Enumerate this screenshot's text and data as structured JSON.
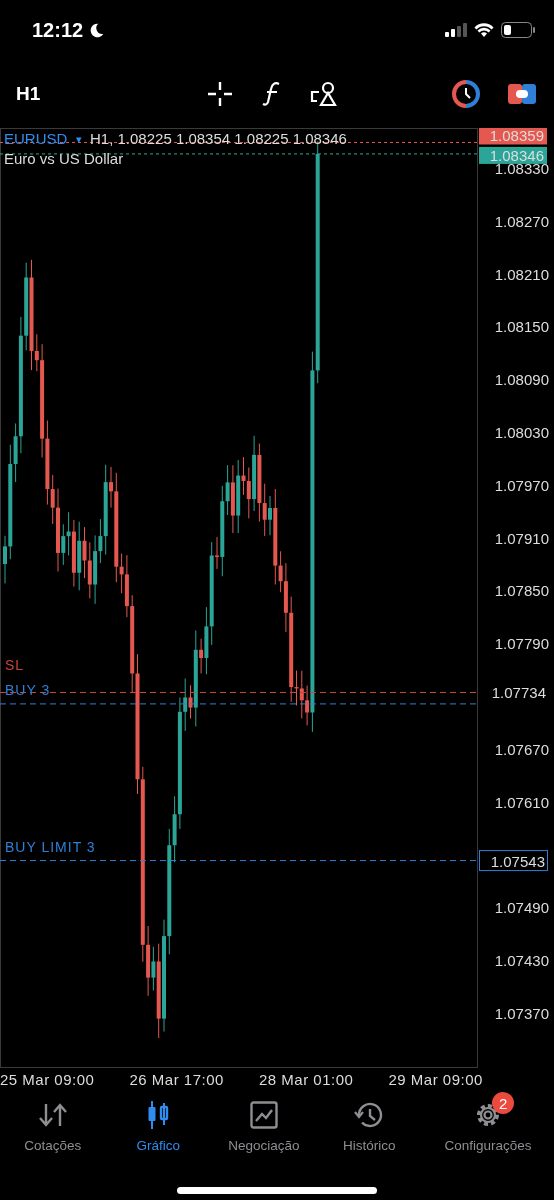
{
  "status_bar": {
    "time": "12:12"
  },
  "toolbar": {
    "timeframe": "H1"
  },
  "chart": {
    "symbol": "EURUSD",
    "dropdown": "▾",
    "ohlc": "H1, 1.08225 1.08354 1.08225 1.08346",
    "description": "Euro vs US Dollar",
    "price_ticks": [
      "1.08330",
      "1.08270",
      "1.08210",
      "1.08150",
      "1.08090",
      "1.08030",
      "1.07970",
      "1.07910",
      "1.07850",
      "1.07790",
      "1.07670",
      "1.07610",
      "1.07490",
      "1.07430",
      "1.07370"
    ],
    "price_lines": [
      {
        "kind": "ask",
        "price": "1.08359",
        "color": "#e5584f"
      },
      {
        "kind": "bid",
        "price": "1.08346",
        "color": "#2ba597"
      }
    ],
    "orders": [
      {
        "kind": "stop",
        "label": "SL",
        "price": "1.07734",
        "color": "#c9463d"
      },
      {
        "kind": "position",
        "label": "BUY 3",
        "color": "#2f7fd6"
      },
      {
        "kind": "limit",
        "label": "BUY LIMIT 3",
        "price": "1.07543",
        "color": "#2f7fd6"
      }
    ],
    "time_labels": [
      "25 Mar 09:00",
      "26 Mar 17:00",
      "28 Mar 01:00",
      "29 Mar 09:00"
    ]
  },
  "tabs": [
    {
      "label": "Cotações",
      "selected": false
    },
    {
      "label": "Gráfico",
      "selected": true
    },
    {
      "label": "Negociação",
      "selected": false
    },
    {
      "label": "Histórico",
      "selected": false
    },
    {
      "label": "Configurações",
      "selected": false,
      "badge": "2"
    }
  ]
}
